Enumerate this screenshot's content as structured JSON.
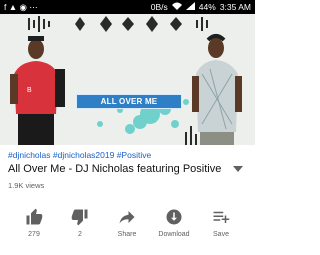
{
  "status_bar": {
    "notifications": "f  ▲  ◉  ⋯",
    "data_rate": "0B/s",
    "battery": "44%",
    "time": "3:35 AM"
  },
  "video": {
    "banner_text": "ALL OVER ME"
  },
  "info": {
    "hashtags": "#djnicholas #djnicholas2019 #Positive",
    "title": "All Over Me - DJ Nicholas featuring Positive",
    "views": "1.9K views"
  },
  "actions": [
    {
      "icon": "thumbs-up-icon",
      "label": "279"
    },
    {
      "icon": "thumbs-down-icon",
      "label": "2"
    },
    {
      "icon": "share-icon",
      "label": "Share"
    },
    {
      "icon": "download-icon",
      "label": "Download"
    },
    {
      "icon": "save-icon",
      "label": "Save"
    }
  ],
  "colors": {
    "hashtag": "#1a5fc6",
    "banner": "#2f7fc7",
    "text": "#111111",
    "secondary": "#606060"
  }
}
